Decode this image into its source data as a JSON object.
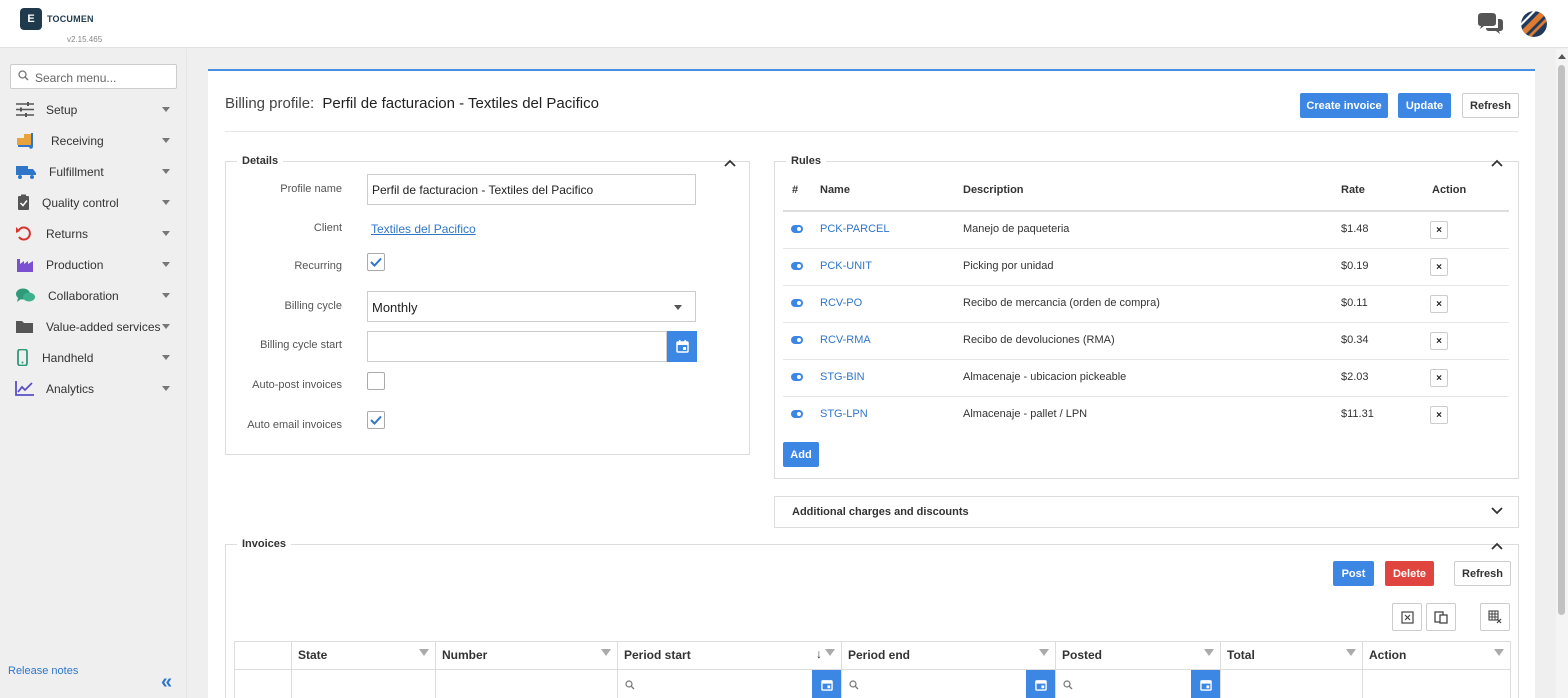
{
  "app": {
    "logo_mark": "E",
    "logo_text": "TOCUMEN",
    "version": "v2.15.465"
  },
  "icons": {
    "chat": "chat-bubbles-icon",
    "search": "magnifier-icon",
    "calendar": "calendar-icon",
    "filter": "filter-funnel-icon"
  },
  "colors": {
    "accent": "#3d87e4",
    "danger": "#e0443e",
    "link": "#2f76c9"
  },
  "sidebar": {
    "search_placeholder": "Search menu...",
    "items": [
      {
        "label": "Setup",
        "icon": "sliders-icon"
      },
      {
        "label": "Receiving",
        "icon": "dolly-boxes-icon"
      },
      {
        "label": "Fulfillment",
        "icon": "truck-icon"
      },
      {
        "label": "Quality control",
        "icon": "clipboard-check-icon"
      },
      {
        "label": "Returns",
        "icon": "undo-icon"
      },
      {
        "label": "Production",
        "icon": "factory-icon"
      },
      {
        "label": "Collaboration",
        "icon": "chat-icon"
      },
      {
        "label": "Value-added services",
        "icon": "folder-icon"
      },
      {
        "label": "Handheld",
        "icon": "mobile-icon"
      },
      {
        "label": "Analytics",
        "icon": "chart-line-icon"
      }
    ],
    "release_notes": "Release notes",
    "collapse_glyph": "«"
  },
  "header": {
    "title_label": "Billing profile:",
    "title_value": "Perfil de facturacion - Textiles del Pacifico",
    "create_invoice": "Create invoice",
    "update": "Update",
    "refresh": "Refresh"
  },
  "details": {
    "legend": "Details",
    "profile_name_label": "Profile name",
    "profile_name_value": "Perfil de facturacion - Textiles del Pacifico",
    "client_label": "Client",
    "client_value": "Textiles del Pacifico",
    "recurring_label": "Recurring",
    "recurring_checked": true,
    "billing_cycle_label": "Billing cycle",
    "billing_cycle_value": "Monthly",
    "billing_cycle_start_label": "Billing cycle start",
    "billing_cycle_start_value": "",
    "auto_post_label": "Auto-post invoices",
    "auto_post_checked": false,
    "auto_email_label": "Auto email invoices",
    "auto_email_checked": true
  },
  "rules": {
    "legend": "Rules",
    "columns": [
      "#",
      "Name",
      "Description",
      "Rate",
      "Action"
    ],
    "rows": [
      {
        "name": "PCK-PARCEL",
        "description": "Manejo de paqueteria",
        "rate": "$1.48"
      },
      {
        "name": "PCK-UNIT",
        "description": "Picking por unidad",
        "rate": "$0.19"
      },
      {
        "name": "RCV-PO",
        "description": "Recibo de mercancia (orden de compra)",
        "rate": "$0.11"
      },
      {
        "name": "RCV-RMA",
        "description": "Recibo de devoluciones (RMA)",
        "rate": "$0.34"
      },
      {
        "name": "STG-BIN",
        "description": "Almacenaje - ubicacion pickeable",
        "rate": "$2.03"
      },
      {
        "name": "STG-LPN",
        "description": "Almacenaje - pallet / LPN",
        "rate": "$11.31"
      }
    ],
    "delete_glyph": "×",
    "add": "Add"
  },
  "additional": {
    "title": "Additional charges and discounts"
  },
  "invoices": {
    "legend": "Invoices",
    "post": "Post",
    "delete": "Delete",
    "refresh": "Refresh",
    "sort_glyph": "↓",
    "columns": [
      "State",
      "Number",
      "Period start",
      "Period end",
      "Posted",
      "Total",
      "Action"
    ]
  }
}
